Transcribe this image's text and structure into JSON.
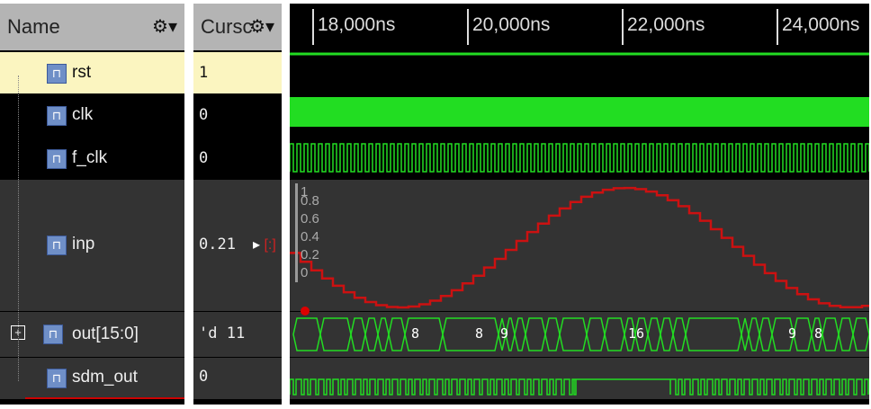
{
  "columns": {
    "name": "Name",
    "value": "Cursc"
  },
  "signals": [
    {
      "name": "rst",
      "value": "1"
    },
    {
      "name": "clk",
      "value": "0"
    },
    {
      "name": "f_clk",
      "value": "0"
    },
    {
      "name": "inp",
      "value": "0.21"
    },
    {
      "name": "out[15:0]",
      "value": "'d 11"
    },
    {
      "name": "sdm_out",
      "value": "0"
    }
  ],
  "ruler": [
    "18,000ns",
    "20,000ns",
    "22,000ns",
    "24,000ns"
  ],
  "analog_axis": [
    "1",
    "0.8",
    "0.6",
    "0.4",
    "0.2",
    "0"
  ],
  "bus_labels": [
    "8",
    "8",
    "9",
    "16",
    "9",
    "8"
  ],
  "colors": {
    "wave": "#22dd22",
    "analog": "#cc1111",
    "highlight": "#fbf5c0"
  }
}
